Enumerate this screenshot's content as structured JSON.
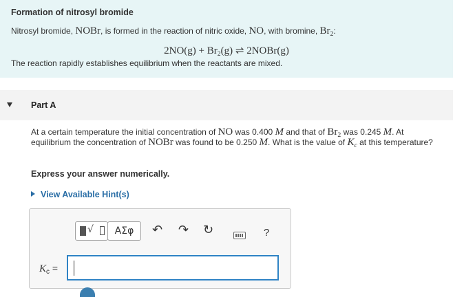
{
  "intro": {
    "title": "Formation of nitrosyl bromide",
    "line1_a": "Nitrosyl bromide, ",
    "line1_nobr": "NOBr",
    "line1_b": ", is formed in the reaction of nitric oxide, ",
    "line1_no": "NO",
    "line1_c": ", with bromine, ",
    "line1_br": "Br",
    "line1_br_sub": "2",
    "line1_d": ":",
    "eq_left_a": "2NO(g) + Br",
    "eq_left_sub": "2",
    "eq_left_b": "(g)",
    "eq_arrow": "⇌",
    "eq_right": "2NOBr(g)",
    "last": "The reaction rapidly establishes equilibrium when the reactants are mixed."
  },
  "part": {
    "label": "Part A"
  },
  "question": {
    "t1": "At a certain temperature the initial concentration of ",
    "no": "NO",
    "t2": " was 0.400 ",
    "m1": "M",
    "t3": " and that of ",
    "br": "Br",
    "br_sub": "2",
    "t4": " was 0.245 ",
    "m2": "M",
    "t5": ". At equilibrium the concentration of ",
    "nobr": "NOBr",
    "t6": " was found to be 0.250 ",
    "m3": "M",
    "t7": ". What is the value of ",
    "k": "K",
    "k_sub": "c",
    "t8": " at this temperature?"
  },
  "express": "Express your answer numerically.",
  "hint": "View Available Hint(s)",
  "toolbar": {
    "greek_label": "ΑΣφ",
    "undo_icon": "↶",
    "redo_icon": "↷",
    "reset_icon": "↻",
    "help_label": "?"
  },
  "answer": {
    "k_symbol": "K",
    "k_sub": "c",
    "equals": "=",
    "value": ""
  },
  "colors": {
    "intro_bg": "#e7f5f6",
    "accent": "#2a6ea6",
    "input_border": "#2f83c5"
  }
}
